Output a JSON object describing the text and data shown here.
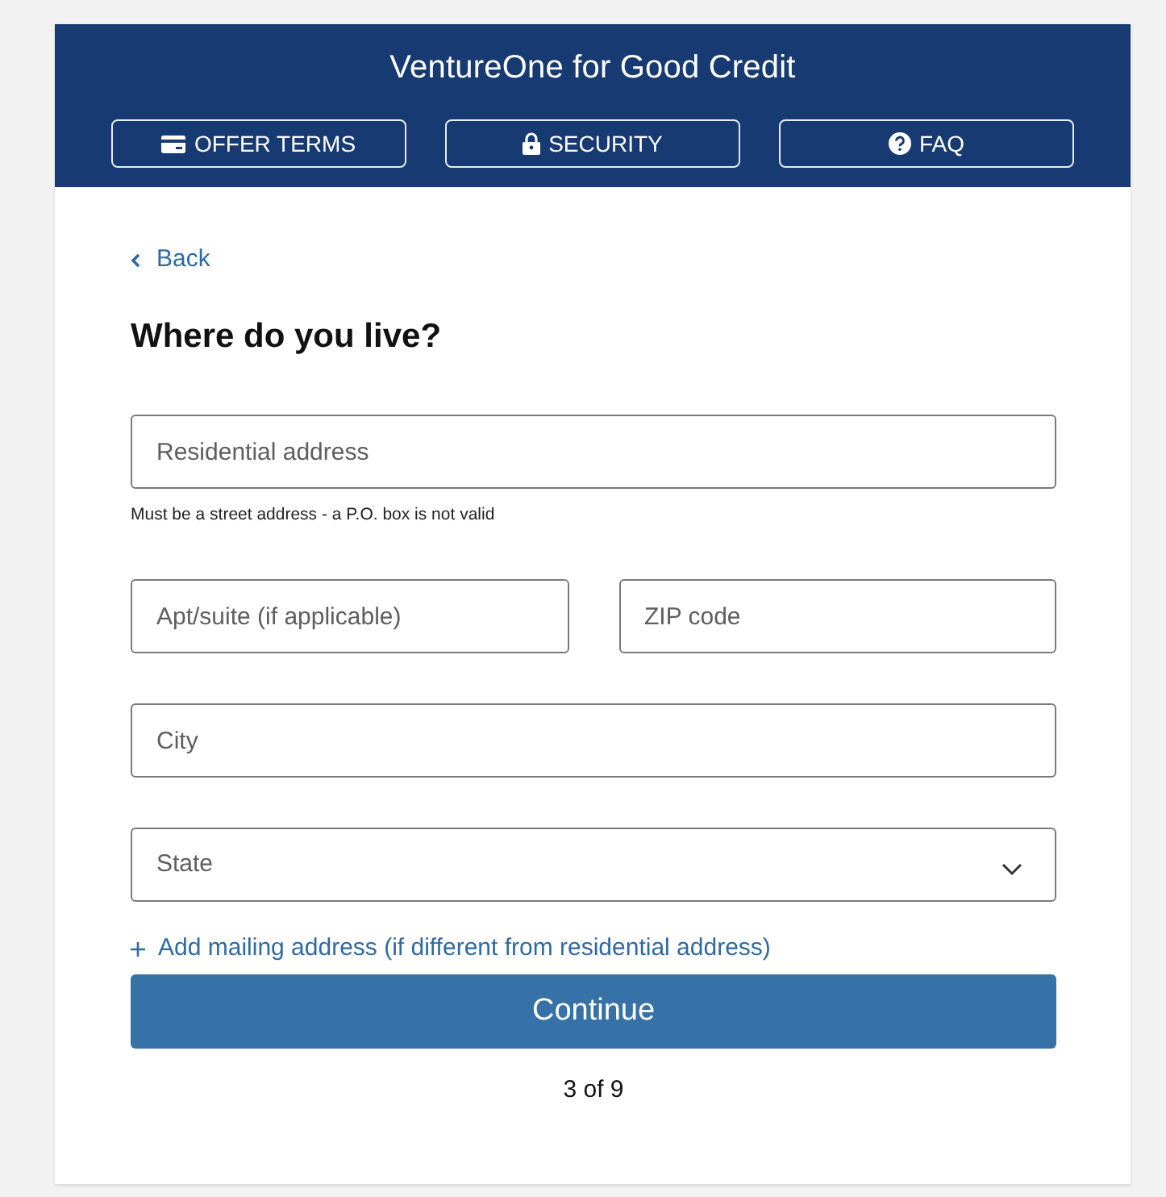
{
  "header": {
    "title": "VentureOne for Good Credit",
    "buttons": [
      {
        "label": "OFFER TERMS"
      },
      {
        "label": "SECURITY"
      },
      {
        "label": "FAQ"
      }
    ]
  },
  "back_link": {
    "label": "Back"
  },
  "heading": "Where do you live?",
  "form": {
    "rows": [
      [
        {
          "kind": "text",
          "placeholder": "Residential address",
          "hint": "Must be a street address - a P.O. box is not valid"
        }
      ],
      [
        {
          "kind": "text",
          "placeholder": "Apt/suite (if applicable)"
        },
        {
          "kind": "text",
          "placeholder": "ZIP code"
        }
      ],
      [
        {
          "kind": "text",
          "placeholder": "City"
        }
      ],
      [
        {
          "kind": "select",
          "placeholder": "State"
        }
      ]
    ]
  },
  "mailing_link": {
    "label": "Add mailing address (if different from residential address)"
  },
  "continue_button": {
    "label": "Continue"
  },
  "progress": "3 of 9"
}
